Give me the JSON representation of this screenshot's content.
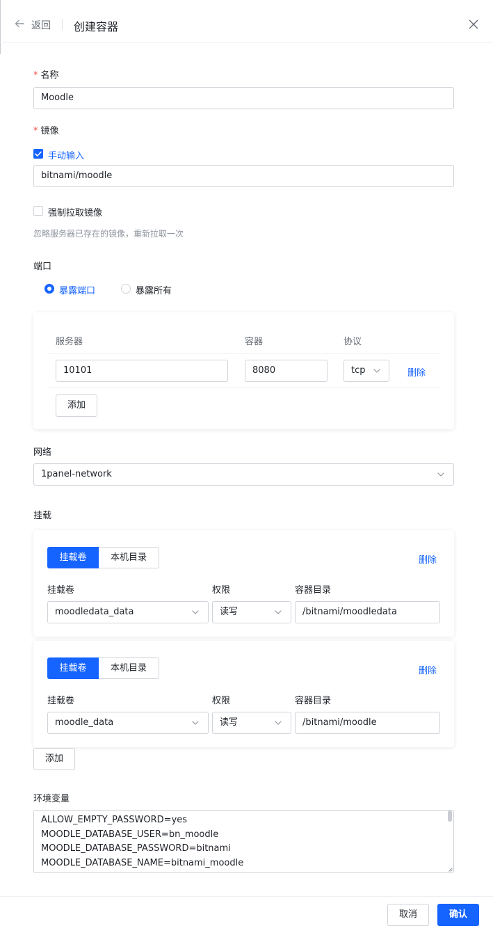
{
  "header": {
    "back_label": "返回",
    "title": "创建容器"
  },
  "form": {
    "name_label": "名称",
    "name_value": "Moodle",
    "image_label": "镜像",
    "manual_input_label": "手动输入",
    "manual_input_checked": true,
    "image_value": "bitnami/moodle",
    "force_pull_label": "强制拉取镜像",
    "force_pull_checked": false,
    "force_pull_hint": "忽略服务器已存在的镜像，重新拉取一次",
    "ports_label": "端口",
    "port_mode_options": [
      "暴露端口",
      "暴露所有"
    ],
    "port_mode_selected": "暴露端口",
    "ports_table": {
      "headers": [
        "服务器",
        "容器",
        "协议"
      ],
      "rows": [
        {
          "server": "10101",
          "container": "8080",
          "protocol": "tcp",
          "delete_label": "删除"
        }
      ],
      "add_label": "添加"
    },
    "network_label": "网络",
    "network_value": "1panel-network",
    "mounts_label": "挂载",
    "mount_type_options": [
      "挂载卷",
      "本机目录"
    ],
    "mount_headers": [
      "挂载卷",
      "权限",
      "容器目录"
    ],
    "mounts": [
      {
        "type": "挂载卷",
        "volume": "moodledata_data",
        "permission": "读写",
        "container_dir": "/bitnami/moodledata",
        "delete_label": "删除"
      },
      {
        "type": "挂载卷",
        "volume": "moodle_data",
        "permission": "读写",
        "container_dir": "/bitnami/moodle",
        "delete_label": "删除"
      }
    ],
    "mounts_add_label": "添加",
    "env_label": "环境变量",
    "env_lines": [
      "ALLOW_EMPTY_PASSWORD=yes",
      "MOODLE_DATABASE_USER=bn_moodle",
      "MOODLE_DATABASE_PASSWORD=bitnami",
      "MOODLE_DATABASE_NAME=bitnami_moodle"
    ]
  },
  "footer": {
    "cancel_label": "取消",
    "confirm_label": "确认"
  },
  "colors": {
    "accent": "#1664ff",
    "required": "#f54a45"
  },
  "icons": [
    "back-arrow-icon",
    "close-icon",
    "check-icon",
    "chevron-down-icon"
  ]
}
